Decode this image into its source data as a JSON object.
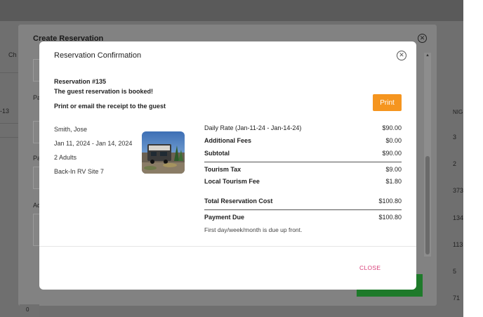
{
  "background": {
    "left_cut_labels": [
      "Ch",
      "Pa",
      "Pa",
      "Ad"
    ],
    "left_row_label": "-13",
    "column_header": "NIG",
    "column_values": [
      "3",
      "2",
      "373",
      "134",
      "113",
      "5",
      "71"
    ],
    "bottom_value": "0"
  },
  "create_dialog": {
    "title": "Create Reservation",
    "close_icon": "close-icon"
  },
  "modal": {
    "title": "Reservation Confirmation",
    "close_icon": "close-icon",
    "reservation_number": "Reservation #135",
    "booked_message": "The guest reservation is booked!",
    "print_message": "Print or email the receipt to the guest",
    "print_label": "Print",
    "accent_color": "#f5951f",
    "close_label": "CLOSE",
    "close_color": "#d9417a"
  },
  "guest": {
    "name": "Smith, Jose",
    "dates": "Jan 11, 2024 - Jan 14, 2024",
    "guests": "2 Adults",
    "site": "Back-In RV Site 7",
    "photo_icon": "rv-photo"
  },
  "costs": {
    "daily_rate_label": "Daily Rate (Jan-11-24 - Jan-14-24)",
    "daily_rate_value": "$90.00",
    "additional_fees_label": "Additional Fees",
    "additional_fees_value": "$0.00",
    "subtotal_label": "Subtotal",
    "subtotal_value": "$90.00",
    "tourism_tax_label": "Tourism Tax",
    "tourism_tax_value": "$9.00",
    "local_tourism_fee_label": "Local Tourism Fee",
    "local_tourism_fee_value": "$1.80",
    "total_label": "Total Reservation Cost",
    "total_value": "$100.80",
    "payment_due_label": "Payment Due",
    "payment_due_value": "$100.80",
    "note": "First day/week/month is due up front."
  }
}
